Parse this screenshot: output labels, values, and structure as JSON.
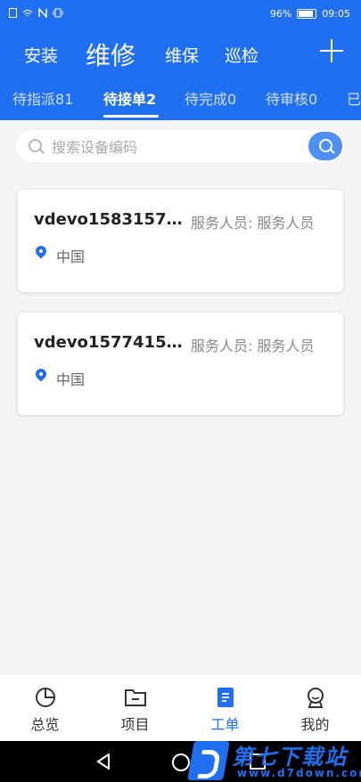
{
  "status": {
    "battery": "96%",
    "time": "09:05"
  },
  "header": {
    "categories": [
      "安装",
      "维修",
      "维保",
      "巡检"
    ],
    "active_category": "维修"
  },
  "tabs": [
    {
      "label": "待指派81"
    },
    {
      "label": "待接单2"
    },
    {
      "label": "待完成0"
    },
    {
      "label": "待审核0"
    },
    {
      "label": "已"
    }
  ],
  "search": {
    "placeholder": "搜索设备编码"
  },
  "cards": [
    {
      "device_id": "vdevo15831571…",
      "staff": "服务人员: 服务人员",
      "location": "中国"
    },
    {
      "device_id": "vdevo15774151…",
      "staff": "服务人员: 服务人员",
      "location": "中国"
    }
  ],
  "bottom_nav": [
    {
      "label": "总览",
      "icon": "pie-chart-icon"
    },
    {
      "label": "项目",
      "icon": "folder-icon"
    },
    {
      "label": "工单",
      "icon": "work-order-icon"
    },
    {
      "label": "我的",
      "icon": "user-icon"
    }
  ],
  "watermark": {
    "title": "第七下载站",
    "url": "www.d7down.com"
  },
  "colors": {
    "primary": "#1f6ff0",
    "background": "#f4f4f4"
  }
}
